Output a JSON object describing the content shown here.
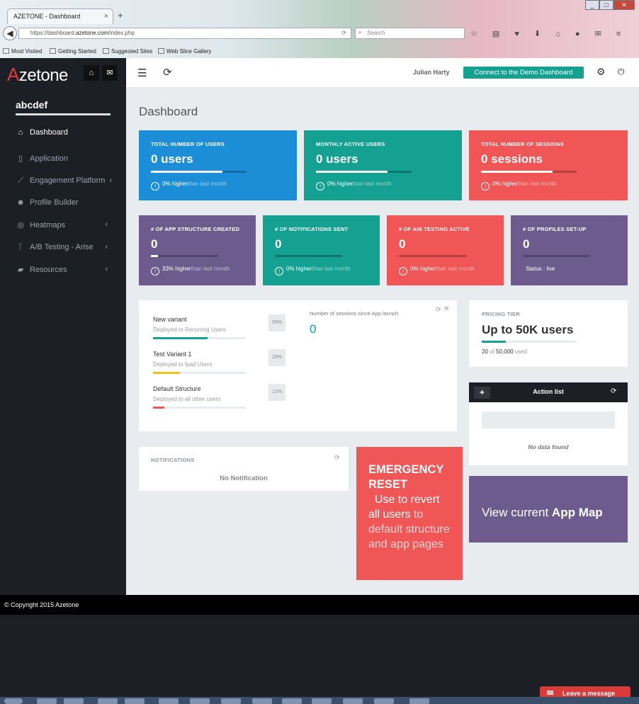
{
  "browser": {
    "tab_title": "AZETONE - Dashboard",
    "tab_close": "×",
    "new_tab": "+",
    "url_prefix": "https://dashboard.",
    "url_domain": "azetone.com",
    "url_path": "/index.php",
    "search_placeholder": "Search",
    "bookmarks": [
      "Most Visited",
      "Getting Started",
      "Suggested Sites",
      "Web Slice Gallery"
    ],
    "window_buttons": [
      "_",
      "□",
      "✕"
    ]
  },
  "app": {
    "logo_a": "A",
    "logo_rest": "zetone",
    "project_name": "abcdef",
    "user_name": "Julian Harty",
    "demo_button": "Connect to the Demo Dashboard",
    "page_title": "Dashboard"
  },
  "sidebar": {
    "items": [
      {
        "label": "Dashboard",
        "icon": "home-icon",
        "active": true
      },
      {
        "label": "Application",
        "icon": "phone-icon"
      },
      {
        "label": "Engagement Platform",
        "icon": "chart-icon",
        "chevron": "‹"
      },
      {
        "label": "Profile Builder",
        "icon": "users-icon"
      },
      {
        "label": "Heatmaps",
        "icon": "target-icon",
        "chevron": "‹"
      },
      {
        "label": "A/B Testing - Arise",
        "icon": "branch-icon",
        "chevron": "‹"
      },
      {
        "label": "Resources",
        "icon": "folder-icon",
        "chevron": "‹"
      }
    ]
  },
  "stats_row1": [
    {
      "label": "TOTAL NUMBER OF USERS",
      "value": "0 users",
      "change": "0% higher",
      "period": "than last month",
      "color": "#1c8ed8",
      "progress": 0.75
    },
    {
      "label": "MONTHLY ACTIVE USERS",
      "value": "0 users",
      "change": "0% higher",
      "period": "than last month",
      "color": "#14a191",
      "progress": 0.75
    },
    {
      "label": "TOTAL NUMBER OF SESSIONS",
      "value": "0 sessions",
      "change": "0% higher",
      "period": "than last month",
      "color": "#f05656",
      "progress": 0.75
    }
  ],
  "stats_row2": [
    {
      "label": "# OF APP STRUCTURE CREATED",
      "value": "0",
      "change": "33% higher",
      "period": "than last month",
      "color": "#6e5b8e",
      "progress": 0.1
    },
    {
      "label": "# OF NOTIFICATIONS SENT",
      "value": "0",
      "change": "0% higher",
      "period": "than last month",
      "color": "#14a191",
      "progress": 0
    },
    {
      "label": "# OF A/B TESTING ACTIVE",
      "value": "0",
      "change": "0% higher",
      "period": "than last month",
      "color": "#f05656",
      "progress": 0
    },
    {
      "label": "# OF PROFILES SET-UP",
      "value": "0",
      "status": "Status : live",
      "color": "#6e5b8e",
      "progress": 0
    }
  ],
  "variants": [
    {
      "name": "New variant",
      "desc": "Deployed to Recurring Users",
      "pct": "59%",
      "fill": 0.59,
      "color": "#14a191"
    },
    {
      "name": "Test Variant 1",
      "desc": "Deployed to Ipad Users",
      "pct": "29%",
      "fill": 0.29,
      "color": "#f2c11b"
    },
    {
      "name": "Default Structure",
      "desc": "Deployed to all other users",
      "pct": "12%",
      "fill": 0.12,
      "color": "#f05656"
    }
  ],
  "sessions": {
    "label": "Number of sessions since App launch",
    "value": "0"
  },
  "pricing": {
    "label": "PRICING TIER",
    "title": "Up to 50K users",
    "used": "20",
    "of": "of",
    "total": "50,000",
    "used_label": "used",
    "fill": 0.0004
  },
  "actions": {
    "title": "Action list",
    "add": "+",
    "empty": "No data found"
  },
  "notifications": {
    "label": "NOTIFICATIONS",
    "empty": "No Notification"
  },
  "emergency": {
    "title": "EMERGENCY RESET",
    "part1": "Use to revert",
    "part2": "all users",
    "part3": "to default structure and app pages"
  },
  "appmap": {
    "prefix": "View current",
    "bold": "App Map"
  },
  "footer": {
    "copyright": "© Copyright 2015  Azetone"
  },
  "chat": {
    "label": "Leave a message"
  }
}
